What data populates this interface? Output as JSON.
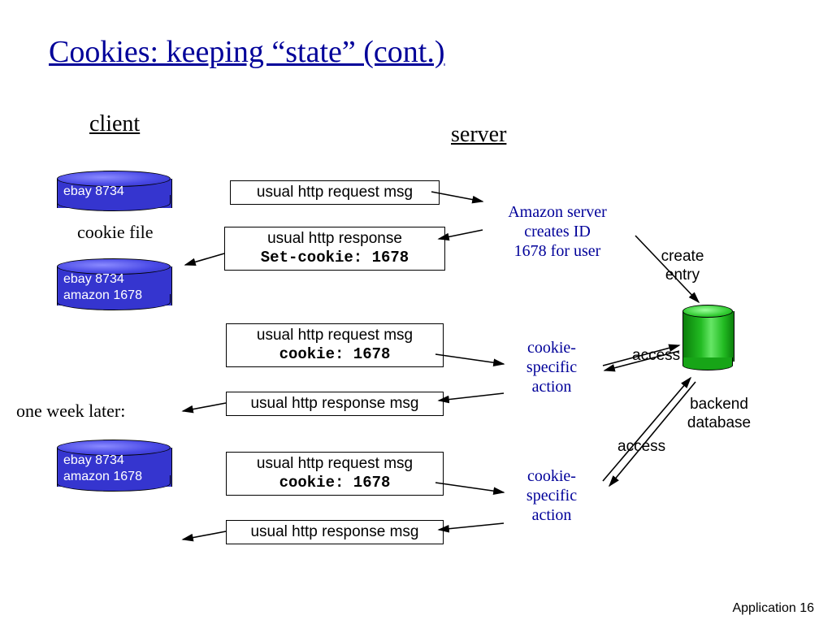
{
  "title": "Cookies: keeping “state” (cont.)",
  "labels": {
    "client": "client",
    "server": "server",
    "cookie_file": "cookie file",
    "one_week": "one week later:",
    "backend": "backend database",
    "create_entry": "create\nentry",
    "access1": "access",
    "access2": "access"
  },
  "cookies": {
    "c1": "ebay 8734",
    "c2": "ebay 8734\namazon 1678",
    "c3": "ebay 8734\namazon 1678"
  },
  "msgs": {
    "m1": "usual http request msg",
    "m2a": "usual http response",
    "m2b": "Set-cookie: 1678",
    "m3a": "usual http request msg",
    "m3b": "cookie: 1678",
    "m4": "usual http response msg",
    "m5a": "usual http request msg",
    "m5b": "cookie: 1678",
    "m6": "usual http response msg"
  },
  "ann": {
    "amazon": "Amazon server\ncreates ID\n1678 for user",
    "csa1": "cookie-\nspecific\naction",
    "csa2": "cookie-\nspecific\naction"
  },
  "footer": "Application  16"
}
